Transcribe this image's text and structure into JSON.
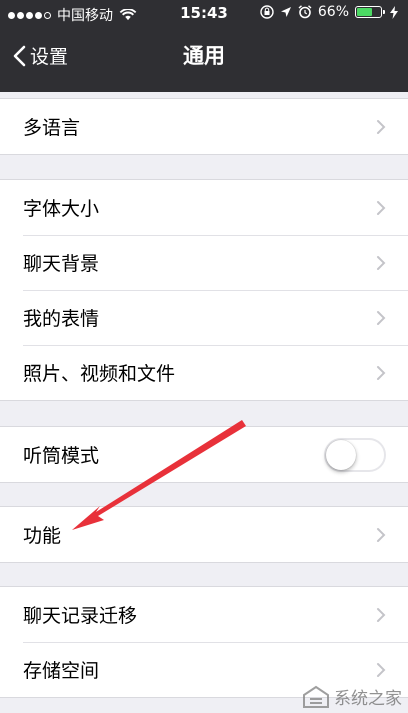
{
  "status_bar": {
    "carrier": "中国移动",
    "time": "15:43",
    "battery_percent": "66%",
    "battery_level": 0.66,
    "battery_color": "#4cd964"
  },
  "nav": {
    "back_label": "设置",
    "title": "通用"
  },
  "groups": [
    {
      "items": [
        {
          "label": "多语言"
        }
      ]
    },
    {
      "items": [
        {
          "label": "字体大小"
        },
        {
          "label": "聊天背景"
        },
        {
          "label": "我的表情"
        },
        {
          "label": "照片、视频和文件"
        }
      ]
    },
    {
      "items": [
        {
          "label": "听筒模式",
          "toggle_on": false
        }
      ]
    },
    {
      "items": [
        {
          "label": "功能"
        }
      ]
    },
    {
      "items": [
        {
          "label": "聊天记录迁移"
        },
        {
          "label": "存储空间"
        }
      ]
    }
  ],
  "annotation": {
    "arrow_color": "#e8313a"
  },
  "watermark": {
    "text": "系统之家"
  },
  "icons": [
    "back-chevron-icon",
    "chevron-right-icon",
    "wifi-icon",
    "lock-rotation-icon",
    "location-icon",
    "alarm-icon",
    "battery-icon",
    "charging-icon"
  ]
}
